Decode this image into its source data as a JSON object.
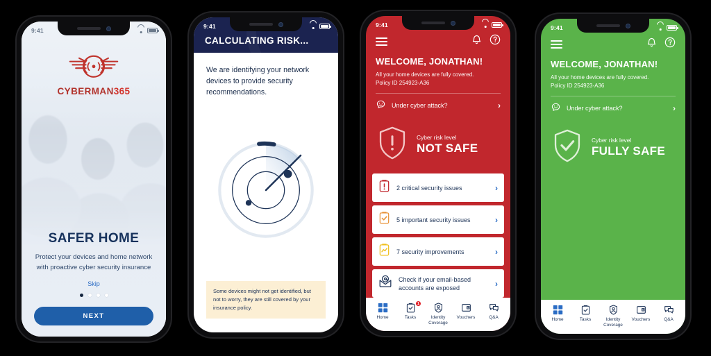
{
  "meta": {
    "status_time": "9:41"
  },
  "colors": {
    "brand_red": "#C1272D",
    "brand_green": "#5AB34A",
    "navy": "#1B2350",
    "button_blue": "#1F5FA9",
    "note_bg": "#FCEFD4",
    "logo_red": "#C0332C",
    "warn_orange": "#E8953C",
    "improve_yellow": "#F0C020"
  },
  "phone1": {
    "status_time": "9:41",
    "brand_name_main": "CYBERMAN",
    "brand_name_suffix": "365",
    "logo_icon": "cyberman-wings-signal-logo",
    "heading": "SAFER HOME",
    "subtext": "Protect your devices and home network with proactive cyber security insurance",
    "skip_label": "Skip",
    "pager": {
      "total": 4,
      "active_index": 0
    },
    "next_label": "NEXT"
  },
  "phone2": {
    "status_time": "9:41",
    "header_title": "CALCULATING RISK...",
    "body_text": "We are identifying your network devices to provide security recommendations.",
    "radar_icon": "radar-scan-graphic",
    "note_text": "Some devices might not get identified, but not to worry, they are still covered by your insurance policy."
  },
  "phone3": {
    "status_time": "9:41",
    "menu_icon": "hamburger-menu-icon",
    "bell_icon": "notification-bell-icon",
    "help_icon": "help-question-icon",
    "welcome": "WELCOME, JONATHAN!",
    "sub_line1": "All your home devices are fully covered.",
    "sub_line2": "Policy ID 254923-A36",
    "attack_icon": "chat-face-icon",
    "attack_label": "Under cyber attack?",
    "risk_label": "Cyber risk level",
    "risk_value": "NOT SAFE",
    "risk_shield_icon": "shield-exclamation-icon",
    "cards": [
      {
        "icon": "clipboard-exclamation-icon",
        "icon_color": "#C1272D",
        "label": "2 critical security issues"
      },
      {
        "icon": "clipboard-check-icon",
        "icon_color": "#E8953C",
        "label": "5 important security issues"
      },
      {
        "icon": "clipboard-chart-icon",
        "icon_color": "#F0C020",
        "label": "7 security improvements"
      },
      {
        "icon": "email-at-icon",
        "icon_color": "#1D3357",
        "label": "Check if your email-based accounts are exposed"
      }
    ],
    "tabs": [
      {
        "icon": "grid-home-icon",
        "label": "Home",
        "badge": null
      },
      {
        "icon": "clipboard-tasks-icon",
        "label": "Tasks",
        "badge": "1"
      },
      {
        "icon": "identity-person-shield-icon",
        "label": "Identity Coverage",
        "badge": null
      },
      {
        "icon": "voucher-card-icon",
        "label": "Vouchers",
        "badge": null
      },
      {
        "icon": "chat-qa-icon",
        "label": "Q&A",
        "badge": null
      }
    ]
  },
  "phone4": {
    "status_time": "9:41",
    "menu_icon": "hamburger-menu-icon",
    "bell_icon": "notification-bell-icon",
    "help_icon": "help-question-icon",
    "welcome": "WELCOME, JONATHAN!",
    "sub_line1": "All your home devices are fully covered.",
    "sub_line2": "Policy ID 254923-A36",
    "attack_icon": "chat-face-icon",
    "attack_label": "Under cyber attack?",
    "risk_label": "Cyber risk level",
    "risk_value": "FULLY SAFE",
    "risk_shield_icon": "shield-check-icon",
    "tabs": [
      {
        "icon": "grid-home-icon",
        "label": "Home",
        "badge": null
      },
      {
        "icon": "clipboard-tasks-icon",
        "label": "Tasks",
        "badge": null
      },
      {
        "icon": "identity-person-shield-icon",
        "label": "Identity Coverage",
        "badge": null
      },
      {
        "icon": "voucher-card-icon",
        "label": "Vouchers",
        "badge": null
      },
      {
        "icon": "chat-qa-icon",
        "label": "Q&A",
        "badge": null
      }
    ]
  }
}
